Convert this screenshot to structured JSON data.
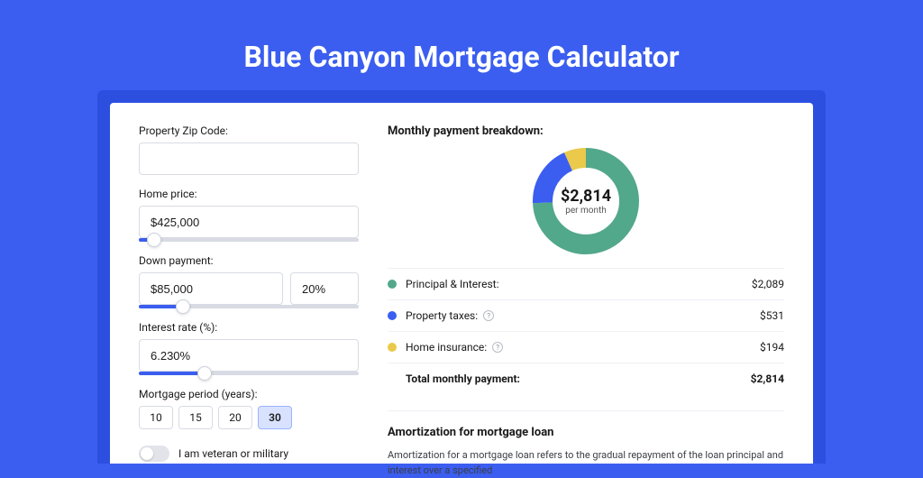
{
  "title": "Blue Canyon Mortgage Calculator",
  "left": {
    "zip_label": "Property Zip Code:",
    "zip_value": "",
    "home_price_label": "Home price:",
    "home_price_value": "$425,000",
    "home_price_slider_pct": 7,
    "down_payment_label": "Down payment:",
    "down_payment_value": "$85,000",
    "down_payment_pct": "20%",
    "down_payment_slider_pct": 20,
    "interest_label": "Interest rate (%):",
    "interest_value": "6.230%",
    "interest_slider_pct": 30,
    "period_label": "Mortgage period (years):",
    "periods": [
      "10",
      "15",
      "20",
      "30"
    ],
    "period_selected": "30",
    "veteran_label": "I am veteran or military"
  },
  "right": {
    "breakdown_title": "Monthly payment breakdown:",
    "center_amount": "$2,814",
    "center_sub": "per month",
    "items": [
      {
        "label": "Principal & Interest:",
        "value": "$2,089",
        "color": "green",
        "info": false
      },
      {
        "label": "Property taxes:",
        "value": "$531",
        "color": "blue",
        "info": true
      },
      {
        "label": "Home insurance:",
        "value": "$194",
        "color": "yellow",
        "info": true
      }
    ],
    "total_label": "Total monthly payment:",
    "total_value": "$2,814",
    "amort_title": "Amortization for mortgage loan",
    "amort_text": "Amortization for a mortgage loan refers to the gradual repayment of the loan principal and interest over a specified"
  },
  "chart_data": {
    "type": "pie",
    "title": "Monthly payment breakdown",
    "series": [
      {
        "name": "Principal & Interest",
        "value": 2089,
        "color": "#52a88a"
      },
      {
        "name": "Property taxes",
        "value": 531,
        "color": "#3b5ef0"
      },
      {
        "name": "Home insurance",
        "value": 194,
        "color": "#eac94b"
      }
    ],
    "total": 2814,
    "center_label": "$2,814 per month"
  }
}
